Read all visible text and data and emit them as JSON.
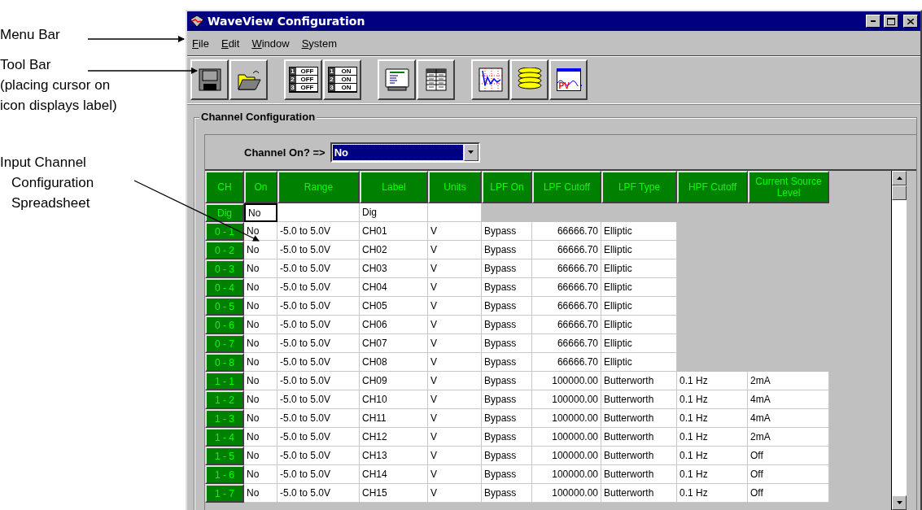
{
  "notes": [
    {
      "kind": "menu",
      "lines": [
        "Menu Bar"
      ]
    },
    {
      "kind": "toolbar",
      "lines": [
        "Tool Bar",
        "(placing cursor on",
        "icon displays label)"
      ]
    },
    {
      "kind": "spreadsheet",
      "lines": [
        "Input Channel",
        "Configuration",
        "Spreadsheet"
      ]
    }
  ],
  "window": {
    "title": "WaveView Configuration"
  },
  "menu": [
    {
      "label": "File"
    },
    {
      "label": "Edit"
    },
    {
      "label": "Window"
    },
    {
      "label": "System"
    }
  ],
  "toolbar": {
    "groups": [
      {
        "buttons": [
          {
            "kind": "save"
          },
          {
            "kind": "open"
          }
        ]
      },
      {
        "buttons": [
          {
            "kind": "switches",
            "rows": [
              {
                "num": "1",
                "text": "OFF"
              },
              {
                "num": "2",
                "text": "OFF"
              },
              {
                "num": "3",
                "text": "OFF"
              }
            ]
          },
          {
            "kind": "switches",
            "rows": [
              {
                "num": "1",
                "text": "ON"
              },
              {
                "num": "2",
                "text": "ON"
              },
              {
                "num": "3",
                "text": "ON"
              }
            ]
          }
        ]
      },
      {
        "buttons": [
          {
            "kind": "display"
          },
          {
            "kind": "table"
          }
        ]
      },
      {
        "buttons": [
          {
            "kind": "chart"
          },
          {
            "kind": "stack"
          },
          {
            "kind": "pv",
            "text": "PV"
          }
        ]
      }
    ]
  },
  "group": {
    "title": "Channel Configuration",
    "combo": {
      "label": "Channel On? =>",
      "value": "No",
      "focused": true
    },
    "table": {
      "columns": [
        "CH",
        "On",
        "Range",
        "Label",
        "Units",
        "LPF On",
        "LPF Cutoff",
        "LPF Type",
        "HPF Cutoff",
        "Current Source Level"
      ],
      "rows": [
        {
          "kind": "digital",
          "selected": true,
          "ch": "Dig",
          "on": "No",
          "label": "Dig"
        },
        {
          "kind": "analog",
          "selected": false,
          "ch": "0 - 1",
          "on": "No",
          "range": "-5.0 to 5.0V",
          "label": "CH01",
          "units": "V",
          "lpf_on": "Bypass",
          "lpf_cutoff": "66666.70",
          "lpf_type": "Elliptic"
        },
        {
          "kind": "analog",
          "selected": false,
          "ch": "0 - 2",
          "on": "No",
          "range": "-5.0 to 5.0V",
          "label": "CH02",
          "units": "V",
          "lpf_on": "Bypass",
          "lpf_cutoff": "66666.70",
          "lpf_type": "Elliptic"
        },
        {
          "kind": "analog",
          "selected": false,
          "ch": "0 - 3",
          "on": "No",
          "range": "-5.0 to 5.0V",
          "label": "CH03",
          "units": "V",
          "lpf_on": "Bypass",
          "lpf_cutoff": "66666.70",
          "lpf_type": "Elliptic"
        },
        {
          "kind": "analog",
          "selected": false,
          "ch": "0 - 4",
          "on": "No",
          "range": "-5.0 to 5.0V",
          "label": "CH04",
          "units": "V",
          "lpf_on": "Bypass",
          "lpf_cutoff": "66666.70",
          "lpf_type": "Elliptic"
        },
        {
          "kind": "analog",
          "selected": false,
          "ch": "0 - 5",
          "on": "No",
          "range": "-5.0 to 5.0V",
          "label": "CH05",
          "units": "V",
          "lpf_on": "Bypass",
          "lpf_cutoff": "66666.70",
          "lpf_type": "Elliptic"
        },
        {
          "kind": "analog",
          "selected": false,
          "ch": "0 - 6",
          "on": "No",
          "range": "-5.0 to 5.0V",
          "label": "CH06",
          "units": "V",
          "lpf_on": "Bypass",
          "lpf_cutoff": "66666.70",
          "lpf_type": "Elliptic"
        },
        {
          "kind": "analog",
          "selected": false,
          "ch": "0 - 7",
          "on": "No",
          "range": "-5.0 to 5.0V",
          "label": "CH07",
          "units": "V",
          "lpf_on": "Bypass",
          "lpf_cutoff": "66666.70",
          "lpf_type": "Elliptic"
        },
        {
          "kind": "analog",
          "selected": false,
          "ch": "0 - 8",
          "on": "No",
          "range": "-5.0 to 5.0V",
          "label": "CH08",
          "units": "V",
          "lpf_on": "Bypass",
          "lpf_cutoff": "66666.70",
          "lpf_type": "Elliptic"
        },
        {
          "kind": "analog_hpf",
          "selected": false,
          "ch": "1 - 1",
          "on": "No",
          "range": "-5.0 to 5.0V",
          "label": "CH09",
          "units": "V",
          "lpf_on": "Bypass",
          "lpf_cutoff": "100000.00",
          "lpf_type": "Butterworth",
          "hpf_cutoff": "0.1 Hz",
          "current": "2mA"
        },
        {
          "kind": "analog_hpf",
          "selected": false,
          "ch": "1 - 2",
          "on": "No",
          "range": "-5.0 to 5.0V",
          "label": "CH10",
          "units": "V",
          "lpf_on": "Bypass",
          "lpf_cutoff": "100000.00",
          "lpf_type": "Butterworth",
          "hpf_cutoff": "0.1 Hz",
          "current": "4mA"
        },
        {
          "kind": "analog_hpf",
          "selected": false,
          "ch": "1 - 3",
          "on": "No",
          "range": "-5.0 to 5.0V",
          "label": "CH11",
          "units": "V",
          "lpf_on": "Bypass",
          "lpf_cutoff": "100000.00",
          "lpf_type": "Butterworth",
          "hpf_cutoff": "0.1 Hz",
          "current": "4mA"
        },
        {
          "kind": "analog_hpf",
          "selected": false,
          "ch": "1 - 4",
          "on": "No",
          "range": "-5.0 to 5.0V",
          "label": "CH12",
          "units": "V",
          "lpf_on": "Bypass",
          "lpf_cutoff": "100000.00",
          "lpf_type": "Butterworth",
          "hpf_cutoff": "0.1 Hz",
          "current": "2mA"
        },
        {
          "kind": "analog_hpf",
          "selected": false,
          "ch": "1 - 5",
          "on": "No",
          "range": "-5.0 to 5.0V",
          "label": "CH13",
          "units": "V",
          "lpf_on": "Bypass",
          "lpf_cutoff": "100000.00",
          "lpf_type": "Butterworth",
          "hpf_cutoff": "0.1 Hz",
          "current": "Off"
        },
        {
          "kind": "analog_hpf",
          "selected": false,
          "ch": "1 - 6",
          "on": "No",
          "range": "-5.0 to 5.0V",
          "label": "CH14",
          "units": "V",
          "lpf_on": "Bypass",
          "lpf_cutoff": "100000.00",
          "lpf_type": "Butterworth",
          "hpf_cutoff": "0.1 Hz",
          "current": "Off"
        },
        {
          "kind": "analog_hpf",
          "selected": false,
          "ch": "1 - 7",
          "on": "No",
          "range": "-5.0 to 5.0V",
          "label": "CH15",
          "units": "V",
          "lpf_on": "Bypass",
          "lpf_cutoff": "100000.00",
          "lpf_type": "Butterworth",
          "hpf_cutoff": "0.1 Hz",
          "current": "Off"
        }
      ]
    }
  }
}
